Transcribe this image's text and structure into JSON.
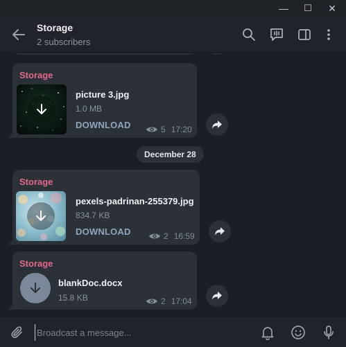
{
  "window": {
    "minimize": "—",
    "maximize": "☐",
    "close": "✕"
  },
  "header": {
    "title": "Storage",
    "subtitle": "2 subscribers"
  },
  "messages": [
    {
      "sender": "Storage",
      "file_name": "picture 3.jpg",
      "file_size": "1.0 MB",
      "action": "DOWNLOAD",
      "views": "5",
      "time": "17:20"
    },
    {
      "sender": "Storage",
      "file_name": "pexels-padrinan-255379.jpg",
      "file_size": "834.7 KB",
      "action": "DOWNLOAD",
      "views": "2",
      "time": "16:59"
    },
    {
      "sender": "Storage",
      "file_name": "blankDoc.docx",
      "file_size": "15.8 KB",
      "views": "2",
      "time": "17:04"
    }
  ],
  "date_separator": "December 28",
  "composer": {
    "placeholder": "Broadcast a message..."
  },
  "colors": {
    "accent_sender": "#e0698b",
    "bubble": "#2c3037",
    "background": "#1b1e24",
    "link": "#8fa6bd"
  },
  "icons": [
    "back-arrow-icon",
    "search-icon",
    "voice-chat-icon",
    "sidebar-toggle-icon",
    "more-vertical-icon",
    "download-icon",
    "eye-icon",
    "share-icon",
    "attach-icon",
    "bell-icon",
    "emoji-icon",
    "microphone-icon"
  ]
}
